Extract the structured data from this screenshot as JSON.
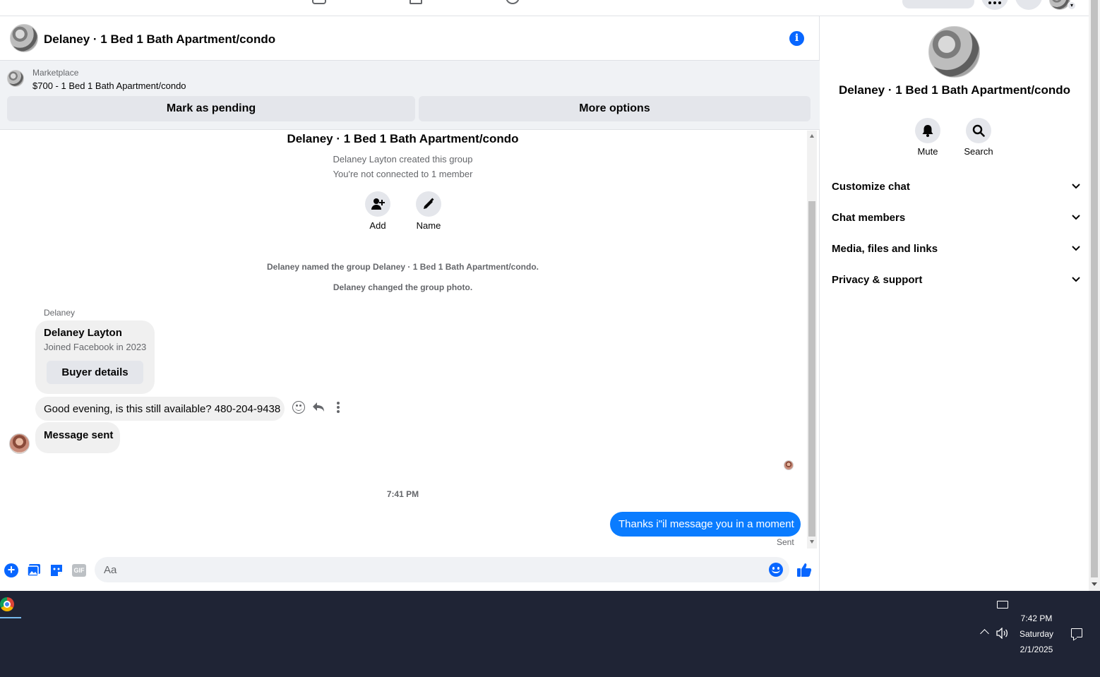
{
  "colors": {
    "accent": "#0866ff",
    "sent_bubble": "#0a7cff",
    "button_grey": "#e4e6eb",
    "taskbar": "#1f2435"
  },
  "header": {
    "title": "Delaney · 1 Bed 1 Bath Apartment/condo",
    "info_icon": "info-icon"
  },
  "listing": {
    "source": "Marketplace",
    "price_title": "$700 - 1 Bed 1 Bath Apartment/condo",
    "mark_pending_label": "Mark as pending",
    "more_options_label": "More options"
  },
  "thread": {
    "group_title": "Delaney · 1 Bed 1 Bath Apartment/condo",
    "created_note": "Delaney Layton created this group",
    "connection_note": "You're not connected to 1 member",
    "add_label": "Add",
    "name_label": "Name",
    "event_named": "Delaney named the group Delaney · 1 Bed 1 Bath Apartment/condo.",
    "event_photo": "Delaney changed the group photo.",
    "sender_name": "Delaney",
    "profile_card": {
      "name": "Delaney Layton",
      "joined": "Joined Facebook in 2023",
      "button": "Buyer details"
    },
    "msg1": "Good evening, is this still available? 480-204-9438",
    "msg2": "Message sent",
    "timestamp": "7:41 PM",
    "my_msg": "Thanks i\"il message you in a moment",
    "sent_status": "Sent"
  },
  "composer": {
    "placeholder": "Aa",
    "icons": [
      "plus-icon",
      "photo-icon",
      "sticker-icon",
      "gif-icon",
      "emoji-icon",
      "thumbs-up-icon"
    ],
    "gif_label": "GIF"
  },
  "side": {
    "title": "Delaney · 1 Bed 1 Bath Apartment/condo",
    "mute_label": "Mute",
    "search_label": "Search",
    "sections": [
      "Customize chat",
      "Chat members",
      "Media, files and links",
      "Privacy & support"
    ]
  },
  "taskbar": {
    "time": "7:42 PM",
    "day": "Saturday",
    "date": "2/1/2025"
  }
}
